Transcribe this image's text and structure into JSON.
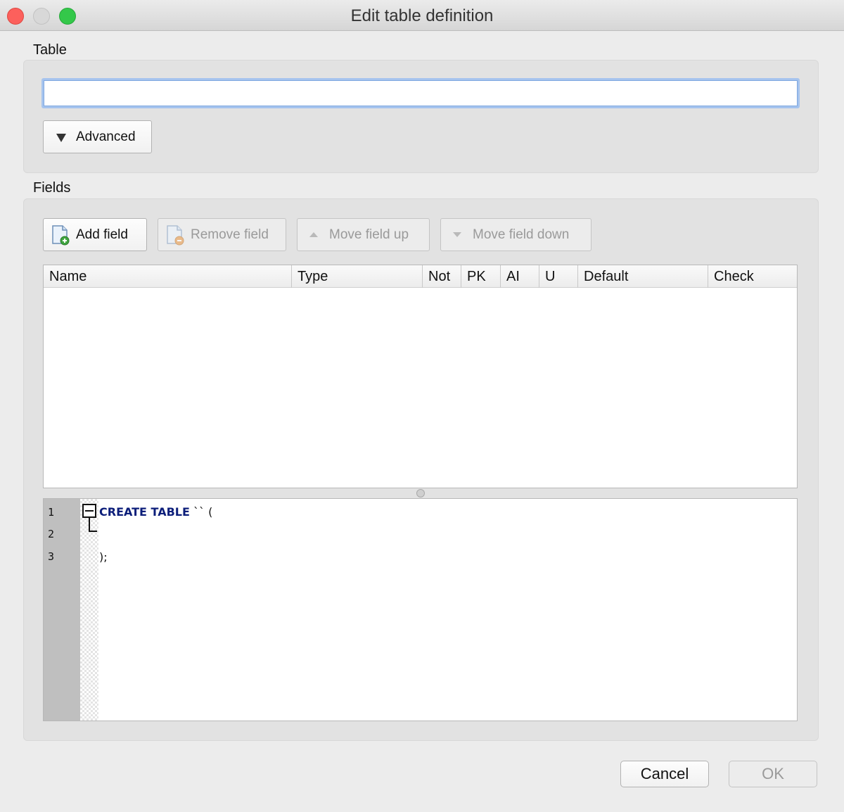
{
  "window": {
    "title": "Edit table definition"
  },
  "table_section": {
    "label": "Table",
    "name_value": "",
    "advanced_label": "Advanced"
  },
  "fields_section": {
    "label": "Fields",
    "toolbar": {
      "add": "Add field",
      "remove": "Remove field",
      "move_up": "Move field up",
      "move_down": "Move field down"
    },
    "columns": [
      "Name",
      "Type",
      "Not",
      "PK",
      "AI",
      "U",
      "Default",
      "Check"
    ],
    "rows": []
  },
  "sql_editor": {
    "line_numbers": [
      "1",
      "2",
      "3"
    ],
    "line1_keyword": "CREATE TABLE",
    "line1_rest": " `` (",
    "line2": "",
    "line3": ");",
    "keyword_color": "#0c1e7a"
  },
  "footer": {
    "cancel": "Cancel",
    "ok": "OK"
  }
}
